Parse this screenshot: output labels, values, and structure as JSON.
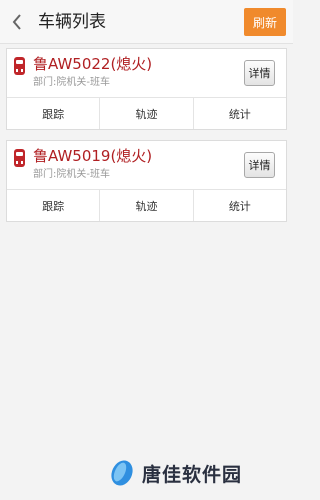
{
  "header": {
    "title": "车辆列表",
    "refresh_label": "刷新"
  },
  "vehicles": [
    {
      "name": "鲁AW5022(熄火)",
      "department": "部门:院机关-班车",
      "detail_label": "详情",
      "actions": [
        "跟踪",
        "轨迹",
        "统计"
      ]
    },
    {
      "name": "鲁AW5019(熄火)",
      "department": "部门:院机关-班车",
      "detail_label": "详情",
      "actions": [
        "跟踪",
        "轨迹",
        "统计"
      ]
    }
  ],
  "watermark": {
    "text": "唐佳软件园"
  },
  "colors": {
    "accent": "#f08a2c",
    "status_off": "#b01f22"
  }
}
